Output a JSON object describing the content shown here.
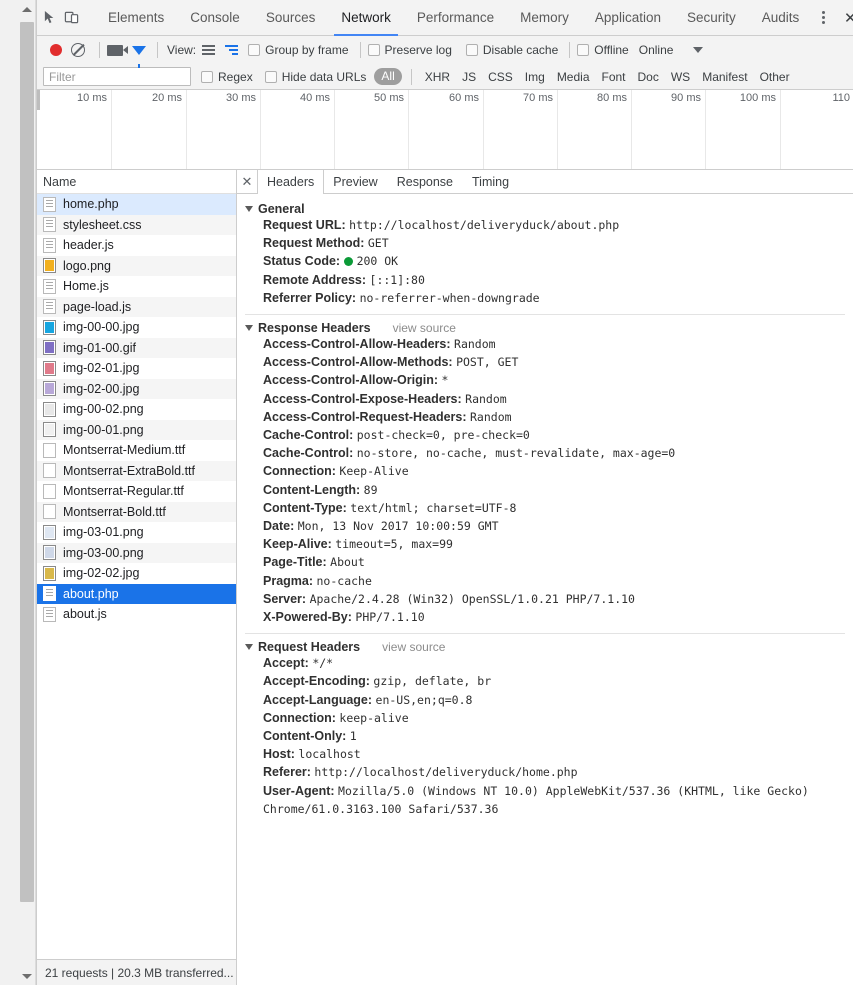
{
  "window": {
    "main_tabs": [
      {
        "label": "Elements",
        "active": false
      },
      {
        "label": "Console",
        "active": false
      },
      {
        "label": "Sources",
        "active": false
      },
      {
        "label": "Network",
        "active": true
      },
      {
        "label": "Performance",
        "active": false
      },
      {
        "label": "Memory",
        "active": false
      },
      {
        "label": "Application",
        "active": false
      },
      {
        "label": "Security",
        "active": false
      },
      {
        "label": "Audits",
        "active": false
      }
    ],
    "inspect_icon": "inspect-element-icon",
    "device_icon": "device-toolbar-icon",
    "menu_icon": "kebab-menu-icon",
    "close_icon": "close-icon",
    "close_glyph": "✕"
  },
  "toolbar": {
    "record_icon": "record-button",
    "clear_icon": "clear-button",
    "camera_icon": "capture-screenshots-icon",
    "filter_icon": "filter-icon",
    "view_label": "View:",
    "view_list_icon": "view-list-icon",
    "view_waterfall_icon": "view-waterfall-icon",
    "group_by_frame": "Group by frame",
    "preserve_log": "Preserve log",
    "disable_cache": "Disable cache",
    "offline": "Offline",
    "throttle_value": "Online",
    "throttle_caret_icon": "chevron-down-icon"
  },
  "filterbar": {
    "placeholder": "Filter",
    "value": "",
    "regex": "Regex",
    "hide_data_urls": "Hide data URLs",
    "all_pill": "All",
    "types": [
      "XHR",
      "JS",
      "CSS",
      "Img",
      "Media",
      "Font",
      "Doc",
      "WS",
      "Manifest",
      "Other"
    ]
  },
  "overview": {
    "ticks": [
      "10 ms",
      "20 ms",
      "30 ms",
      "40 ms",
      "50 ms",
      "60 ms",
      "70 ms",
      "80 ms",
      "90 ms",
      "100 ms",
      "110"
    ]
  },
  "filelist": {
    "column_header": "Name",
    "status": "21 requests  |  20.3 MB transferred...",
    "rows": [
      {
        "name": "home.php",
        "type": "doc",
        "state": "soft-selected"
      },
      {
        "name": "stylesheet.css",
        "type": "doc",
        "state": "normal"
      },
      {
        "name": "header.js",
        "type": "doc",
        "state": "normal"
      },
      {
        "name": "logo.png",
        "type": "img",
        "color": "#f2b01e",
        "state": "normal"
      },
      {
        "name": "Home.js",
        "type": "doc",
        "state": "normal"
      },
      {
        "name": "page-load.js",
        "type": "doc",
        "state": "normal"
      },
      {
        "name": "img-00-00.jpg",
        "type": "img",
        "color": "#17a6e0",
        "state": "normal"
      },
      {
        "name": "img-01-00.gif",
        "type": "img",
        "color": "#7f6fc4",
        "state": "normal"
      },
      {
        "name": "img-02-01.jpg",
        "type": "img",
        "color": "#e07a8a",
        "state": "normal"
      },
      {
        "name": "img-02-00.jpg",
        "type": "img",
        "color": "#b8a8d8",
        "state": "normal"
      },
      {
        "name": "img-00-02.png",
        "type": "img",
        "color": "#e8e8e8",
        "state": "normal"
      },
      {
        "name": "img-00-01.png",
        "type": "img",
        "color": "#f0f0f0",
        "state": "normal"
      },
      {
        "name": "Montserrat-Medium.ttf",
        "type": "font",
        "state": "normal"
      },
      {
        "name": "Montserrat-ExtraBold.ttf",
        "type": "font",
        "state": "normal"
      },
      {
        "name": "Montserrat-Regular.ttf",
        "type": "font",
        "state": "normal"
      },
      {
        "name": "Montserrat-Bold.ttf",
        "type": "font",
        "state": "normal"
      },
      {
        "name": "img-03-01.png",
        "type": "img",
        "color": "#dfe7f2",
        "state": "normal"
      },
      {
        "name": "img-03-00.png",
        "type": "img",
        "color": "#cfd8e8",
        "state": "normal"
      },
      {
        "name": "img-02-02.jpg",
        "type": "img",
        "color": "#d8b84a",
        "state": "normal"
      },
      {
        "name": "about.php",
        "type": "doc",
        "state": "selected"
      },
      {
        "name": "about.js",
        "type": "doc",
        "state": "normal"
      }
    ]
  },
  "details": {
    "close_glyph": "✕",
    "tabs": [
      {
        "label": "Headers",
        "active": true
      },
      {
        "label": "Preview",
        "active": false
      },
      {
        "label": "Response",
        "active": false
      },
      {
        "label": "Timing",
        "active": false
      }
    ],
    "sections": [
      {
        "title": "General",
        "view_source": "",
        "rows": [
          {
            "key": "Request URL:",
            "value": "http://localhost/deliveryduck/about.php"
          },
          {
            "key": "Request Method:",
            "value": "GET"
          },
          {
            "key": "Status Code:",
            "value": "200 OK",
            "status_dot": true
          },
          {
            "key": "Remote Address:",
            "value": "[::1]:80"
          },
          {
            "key": "Referrer Policy:",
            "value": "no-referrer-when-downgrade"
          }
        ]
      },
      {
        "title": "Response Headers",
        "view_source": "view source",
        "rows": [
          {
            "key": "Access-Control-Allow-Headers:",
            "value": "Random"
          },
          {
            "key": "Access-Control-Allow-Methods:",
            "value": "POST, GET"
          },
          {
            "key": "Access-Control-Allow-Origin:",
            "value": "*"
          },
          {
            "key": "Access-Control-Expose-Headers:",
            "value": "Random"
          },
          {
            "key": "Access-Control-Request-Headers:",
            "value": "Random"
          },
          {
            "key": "Cache-Control:",
            "value": "post-check=0, pre-check=0"
          },
          {
            "key": "Cache-Control:",
            "value": "no-store, no-cache, must-revalidate, max-age=0"
          },
          {
            "key": "Connection:",
            "value": "Keep-Alive"
          },
          {
            "key": "Content-Length:",
            "value": "89"
          },
          {
            "key": "Content-Type:",
            "value": "text/html; charset=UTF-8"
          },
          {
            "key": "Date:",
            "value": "Mon, 13 Nov 2017 10:00:59 GMT"
          },
          {
            "key": "Keep-Alive:",
            "value": "timeout=5, max=99"
          },
          {
            "key": "Page-Title:",
            "value": "About"
          },
          {
            "key": "Pragma:",
            "value": "no-cache"
          },
          {
            "key": "Server:",
            "value": "Apache/2.4.28 (Win32) OpenSSL/1.0.21 PHP/7.1.10"
          },
          {
            "key": "X-Powered-By:",
            "value": "PHP/7.1.10"
          }
        ]
      },
      {
        "title": "Request Headers",
        "view_source": "view source",
        "rows": [
          {
            "key": "Accept:",
            "value": "*/*"
          },
          {
            "key": "Accept-Encoding:",
            "value": "gzip, deflate, br"
          },
          {
            "key": "Accept-Language:",
            "value": "en-US,en;q=0.8"
          },
          {
            "key": "Connection:",
            "value": "keep-alive"
          },
          {
            "key": "Content-Only:",
            "value": "1"
          },
          {
            "key": "Host:",
            "value": "localhost"
          },
          {
            "key": "Referer:",
            "value": "http://localhost/deliveryduck/home.php"
          },
          {
            "key": "User-Agent:",
            "value": "Mozilla/5.0 (Windows NT 10.0) AppleWebKit/537.36 (KHTML, like Gecko) Chrome/61.0.3163.100 Safari/537.36"
          }
        ]
      }
    ]
  },
  "colors": {
    "accent": "#1a73e8",
    "record": "#e12d2d",
    "status_ok": "#0b9a37",
    "selected_row": "#1a73e8",
    "soft_selected_row": "#dbeafe"
  }
}
